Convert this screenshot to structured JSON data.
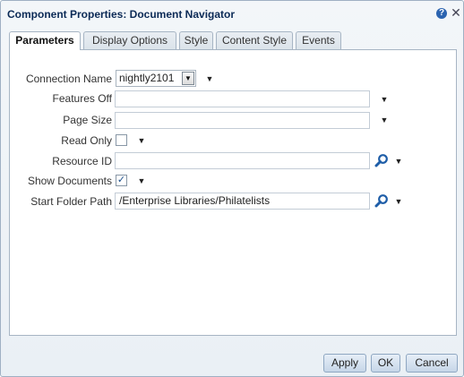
{
  "dialog": {
    "title": "Component Properties: Document Navigator",
    "help_icon": "?",
    "close_icon": "✕"
  },
  "tabs": [
    {
      "label": "Parameters",
      "active": true
    },
    {
      "label": "Display Options",
      "active": false
    },
    {
      "label": "Style",
      "active": false
    },
    {
      "label": "Content Style",
      "active": false
    },
    {
      "label": "Events",
      "active": false
    }
  ],
  "fields": {
    "connection_name": {
      "label": "Connection Name",
      "value": "nightly2101"
    },
    "features_off": {
      "label": "Features Off",
      "value": ""
    },
    "page_size": {
      "label": "Page Size",
      "value": ""
    },
    "read_only": {
      "label": "Read Only",
      "checked": false
    },
    "resource_id": {
      "label": "Resource ID",
      "value": ""
    },
    "show_documents": {
      "label": "Show Documents",
      "checked": true
    },
    "start_folder_path": {
      "label": "Start Folder Path",
      "value": "/Enterprise Libraries/Philatelists"
    }
  },
  "buttons": {
    "apply": "Apply",
    "ok": "OK",
    "cancel": "Cancel"
  },
  "colors": {
    "title": "#0b2a56",
    "search_icon": "#1f5ea8"
  }
}
